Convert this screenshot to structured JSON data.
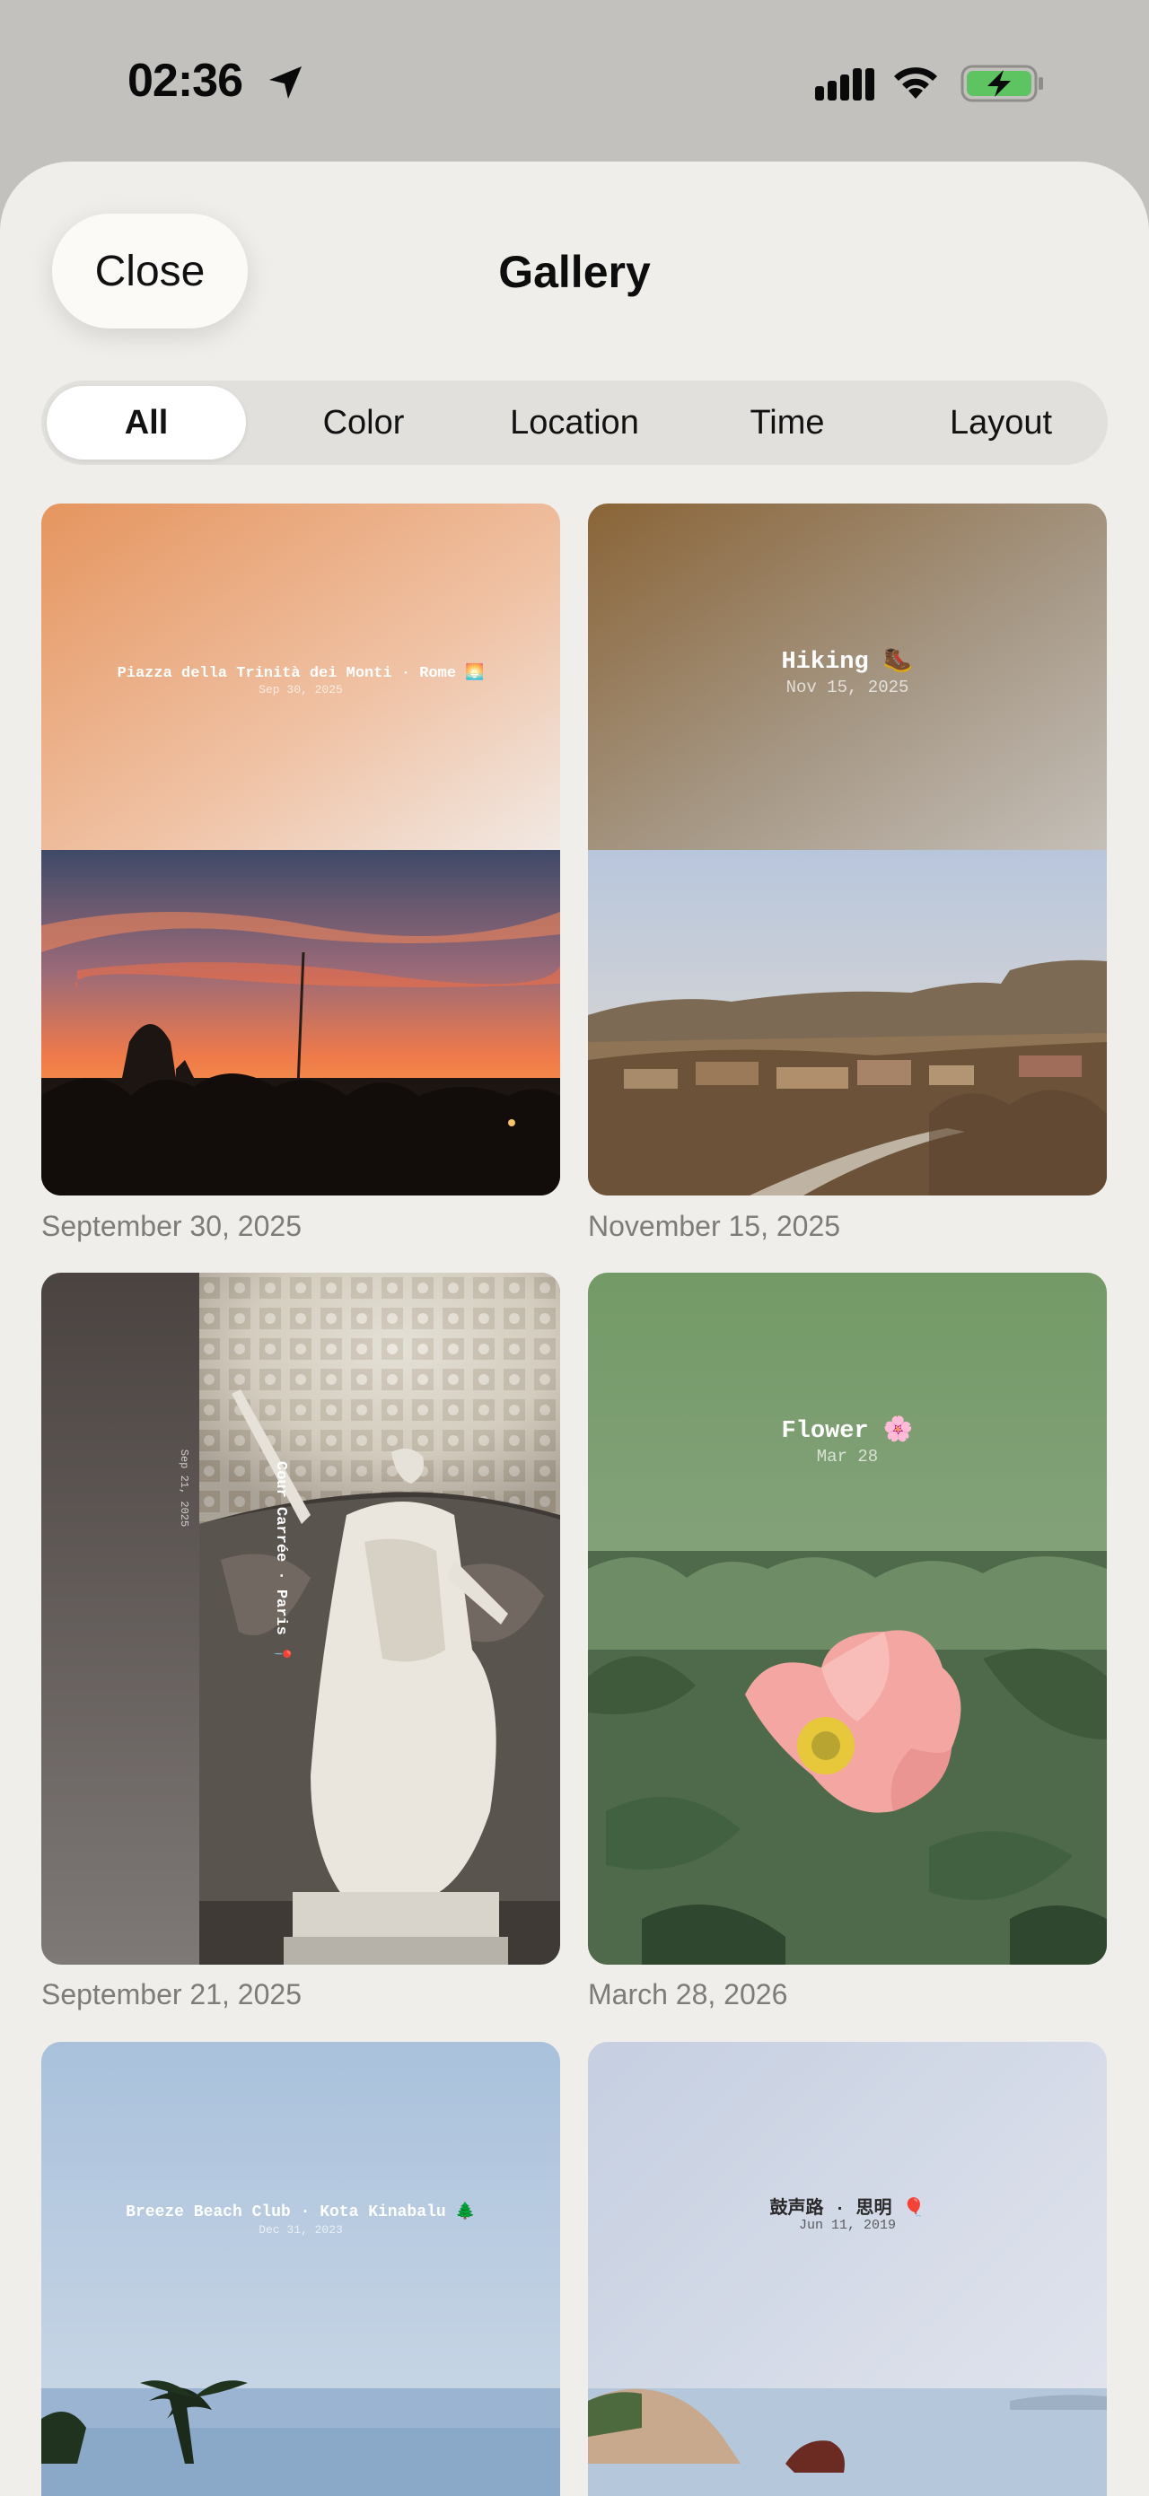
{
  "status_bar": {
    "time": "02:36"
  },
  "header": {
    "close_label": "Close",
    "title": "Gallery"
  },
  "tabs": [
    {
      "label": "All",
      "active": true
    },
    {
      "label": "Color",
      "active": false
    },
    {
      "label": "Location",
      "active": false
    },
    {
      "label": "Time",
      "active": false
    },
    {
      "label": "Layout",
      "active": false
    }
  ],
  "cards": [
    {
      "overlay_title": "Piazza della Trinità dei Monti · Rome 🌅",
      "overlay_date": "Sep 30, 2025",
      "caption": "September 30, 2025"
    },
    {
      "overlay_title": "Hiking 🥾",
      "overlay_date": "Nov 15, 2025",
      "caption": "November 15, 2025"
    },
    {
      "overlay_title": "Cour Carrée · Paris 📍",
      "overlay_date": "Sep 21, 2025",
      "caption": "September 21, 2025"
    },
    {
      "overlay_title": "Flower 🌸",
      "overlay_date": "Mar 28",
      "caption": "March 28, 2026"
    },
    {
      "overlay_title": "Breeze Beach Club · Kota Kinabalu 🌲",
      "overlay_date": "Dec 31, 2023",
      "caption": ""
    },
    {
      "overlay_title": "鼓声路 · 思明 🎈",
      "overlay_date": "Jun 11, 2019",
      "caption": ""
    }
  ],
  "colors": {
    "background": "#efeeea",
    "status_bar_bg": "#c2c1be",
    "battery_fill": "#5dc461",
    "caption": "#7d7c78"
  }
}
